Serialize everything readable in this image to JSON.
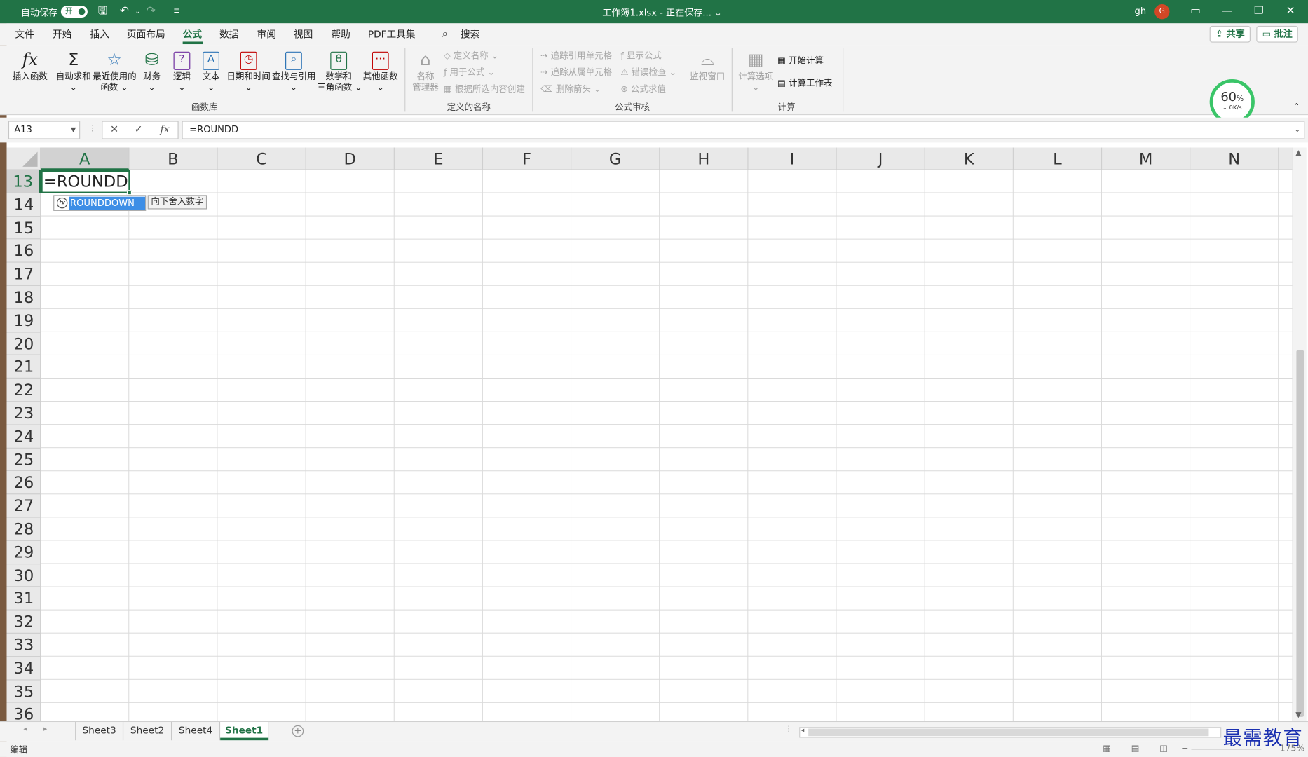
{
  "titlebar": {
    "autosave_label": "自动保存",
    "autosave_state": "开",
    "title": "工作簿1.xlsx - 正在保存... ⌄",
    "user": "gh",
    "avatar_initial": "G"
  },
  "menu": {
    "items": [
      "文件",
      "开始",
      "插入",
      "页面布局",
      "公式",
      "数据",
      "审阅",
      "视图",
      "帮助",
      "PDF工具集"
    ],
    "active": "公式",
    "search": "搜索",
    "share": "共享",
    "comment": "批注"
  },
  "ribbon": {
    "function_library": {
      "buttons": [
        "插入函数",
        "自动求和",
        "最近使用的",
        "函数",
        "财务",
        "逻辑",
        "文本",
        "日期和时间",
        "查找与引用",
        "数学和",
        "三角函数",
        "其他函数"
      ],
      "group_label": "函数库"
    },
    "defined_names": {
      "name_manager": [
        "名称",
        "管理器"
      ],
      "define_name": "定义名称",
      "use_in_formula": "用于公式",
      "create_from_selection": "根据所选内容创建",
      "group_label": "定义的名称"
    },
    "formula_auditing": {
      "trace_precedents": "追踪引用单元格",
      "trace_dependents": "追踪从属单元格",
      "remove_arrows": "删除箭头",
      "show_formulas": "显示公式",
      "error_checking": "错误检查",
      "evaluate_formula": "公式求值",
      "watch_window": "监视窗口",
      "group_label": "公式审核"
    },
    "calculation": {
      "calc_options": "计算选项",
      "calc_now": "开始计算",
      "calc_sheet": "计算工作表",
      "group_label": "计算"
    }
  },
  "speed_widget": {
    "percent": "60",
    "percent_sign": "%",
    "rate": "0K/s"
  },
  "formula_bar": {
    "name_box": "A13",
    "formula": "=ROUNDD"
  },
  "grid": {
    "columns": [
      "A",
      "B",
      "C",
      "D",
      "E",
      "F",
      "G",
      "H",
      "I",
      "J",
      "K",
      "L",
      "M",
      "N"
    ],
    "rows": [
      "13",
      "14",
      "15",
      "16",
      "17",
      "18",
      "19",
      "20",
      "21",
      "22",
      "23",
      "24",
      "25",
      "26",
      "27",
      "28",
      "29",
      "30",
      "31",
      "32",
      "33",
      "34",
      "35",
      "36"
    ],
    "active_column": "A",
    "active_row": "13",
    "active_cell_value": "=ROUNDD"
  },
  "autocomplete": {
    "suggestion": "ROUNDDOWN",
    "tooltip": "向下舍入数字"
  },
  "sheets": {
    "tabs": [
      "Sheet3",
      "Sheet2",
      "Sheet4",
      "Sheet1"
    ],
    "active": "Sheet1"
  },
  "statusbar": {
    "mode": "编辑",
    "zoom": "175%"
  },
  "watermark": "最需教育",
  "colors": {
    "accent": "#217346",
    "autocomplete_highlight": "#3d8ee6",
    "speed_ring": "#3ac568"
  }
}
